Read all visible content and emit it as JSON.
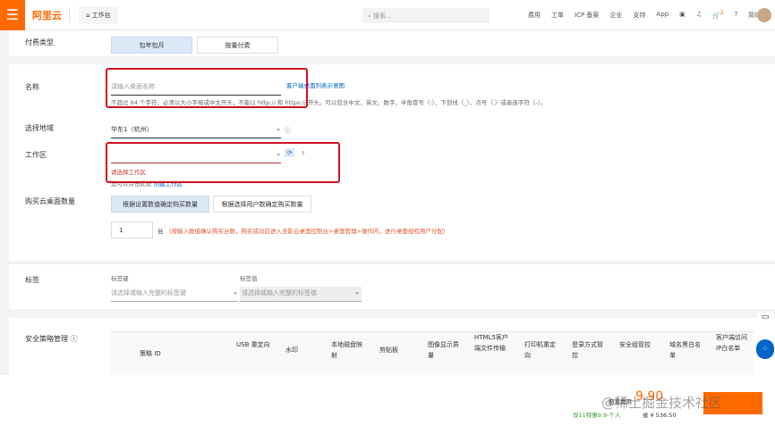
{
  "header": {
    "menu_icon": "hamburger-icon",
    "logo": "阿里云",
    "workbench": "工作台",
    "search_placeholder": "搜索...",
    "nav": [
      "费用",
      "工单",
      "ICP 备案",
      "企业",
      "支持",
      "App"
    ],
    "cart_count": "2",
    "lang": "简体"
  },
  "pay_type": {
    "label": "付费类型",
    "options": [
      "包年包月",
      "按量付费"
    ]
  },
  "name": {
    "label": "名称",
    "placeholder": "请输入桌面名称",
    "link": "客户端桌面列表示意图",
    "hint": "不超过 64 个字符，必须以大小字母或中文开头，不能以 http:// 和 https:// 开头。可以包含中文、英文、数字、半角冒号（:）、下划线（_）、点号（.）或者连字符（-）。"
  },
  "region": {
    "label": "选择地域",
    "value": "华东1（杭州）"
  },
  "workspace": {
    "label": "工作区",
    "error": "请选择工作区",
    "hint": "您可以点击此处",
    "create_link": "创建工作区"
  },
  "quantity": {
    "label": "购买云桌面数量",
    "options": [
      "根据设置数值确定购买数量",
      "根据选择用户数确定购买数量"
    ],
    "value": "1",
    "unit": "台",
    "note": "（按输入数值确认购买台数，购买成功后进入无影云桌面控制台>桌面管理>操作内，进行桌面授权用户分配）"
  },
  "tags": {
    "label": "标签",
    "key_label": "标签键",
    "key_placeholder": "请选择或输入完整的标签键",
    "value_label": "标签值",
    "value_placeholder": "请选择或输入完整的标签值"
  },
  "security": {
    "label": "安全策略管理",
    "columns": [
      "策略 ID",
      "USB 重定向",
      "水印",
      "本地磁盘映射",
      "剪贴板",
      "图像显示质量",
      "HTML5客户端文件传输",
      "打印机重定向",
      "登录方式管控",
      "安全组管控",
      "域名黑白名单",
      "客户端访问IP白名单"
    ]
  },
  "footer": {
    "price_label": "配置费用",
    "price": "9.90",
    "promo": "双11特惠9.9-个人",
    "saving": "省 ¥ 536.50",
    "watermark": "@稀土掘金技术社区"
  }
}
